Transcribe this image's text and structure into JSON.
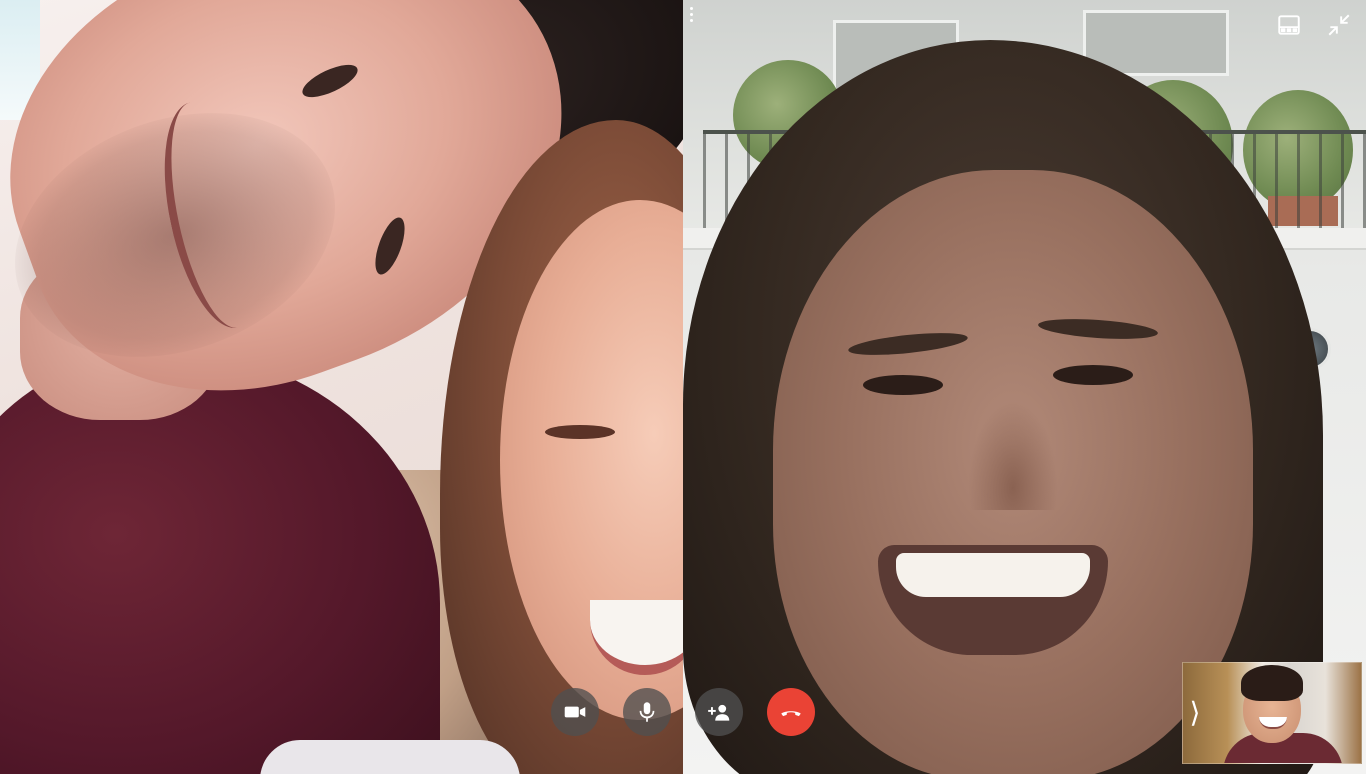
{
  "call": {
    "participants": [
      {
        "id": "left",
        "description": ""
      },
      {
        "id": "right",
        "description": ""
      }
    ]
  },
  "icons": {
    "menu": "more-vertical-icon",
    "layout": "layout-grid-icon",
    "exit_fullscreen": "exit-fullscreen-icon",
    "camera": "video-camera-icon",
    "microphone": "microphone-icon",
    "add_person": "add-person-icon",
    "hangup": "hangup-phone-icon",
    "self_view_toggle": "chevron-right-icon"
  },
  "controls": {
    "self_view_toggle_glyph": "⟩"
  },
  "colors": {
    "control_bg": "#505050",
    "hangup": "#ea4335",
    "icon": "#ffffff"
  }
}
